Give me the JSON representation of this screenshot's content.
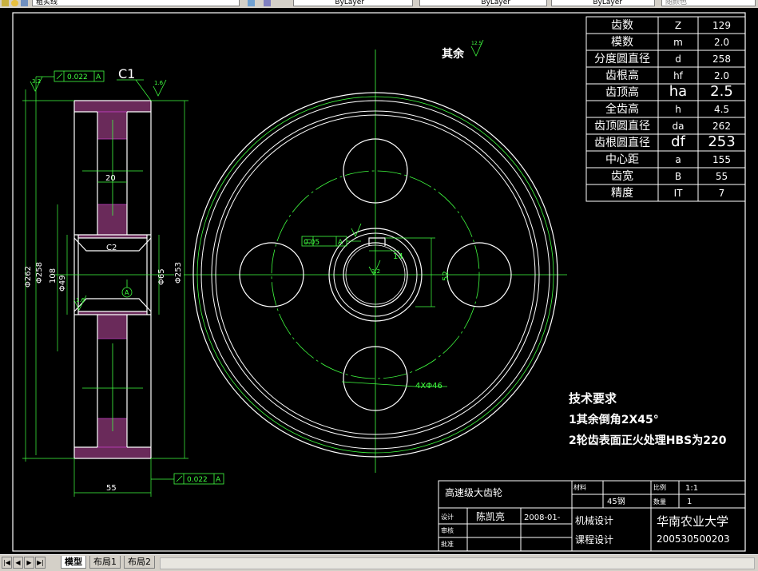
{
  "toolbar": {
    "linetype_value": "粗实线",
    "color_value": "ByLayer",
    "layer_value": "ByLayer",
    "lineweight_value": "ByLayer",
    "plotstyle_value": "随颜色"
  },
  "tabs": {
    "nav": [
      "|◀",
      "◀",
      "▶",
      "▶|"
    ],
    "items": [
      {
        "label": "模型",
        "active": true
      },
      {
        "label": "布局1",
        "active": false
      },
      {
        "label": "布局2",
        "active": false
      }
    ]
  },
  "params_table": [
    {
      "name": "齿数",
      "symbol": "Z",
      "value": "129"
    },
    {
      "name": "模数",
      "symbol": "m",
      "value": "2.0"
    },
    {
      "name": "分度圆直径",
      "symbol": "d",
      "value": "258"
    },
    {
      "name": "齿根高",
      "symbol": "hf",
      "value": "2.0"
    },
    {
      "name": "齿顶高",
      "symbol": "ha",
      "value": "2.5"
    },
    {
      "name": "全齿高",
      "symbol": "h",
      "value": "4.5"
    },
    {
      "name": "齿顶圆直径",
      "symbol": "da",
      "value": "262"
    },
    {
      "name": "齿根圆直径",
      "symbol": "df",
      "value": "253"
    },
    {
      "name": "中心距",
      "symbol": "a",
      "value": "155"
    },
    {
      "name": "齿宽",
      "symbol": "B",
      "value": "55"
    },
    {
      "name": "精度",
      "symbol": "IT",
      "value": "7"
    }
  ],
  "rest_roughness": {
    "label": "其余",
    "value": "12.5"
  },
  "tech": {
    "title": "技术要求",
    "line1": "1其余倒角2X45°",
    "line2": "2轮齿表面正火处理HBS为220"
  },
  "title_block": {
    "part_name": "高速级大齿轮",
    "scale_label": "比例",
    "scale_value": "1:1",
    "material_label": "材料",
    "material_value": "45钢",
    "qty_label": "数量",
    "qty_value": "1",
    "design_label": "设计",
    "designer": "陈凯亮",
    "date": "2008-01-",
    "review_label": "审核",
    "approve_label": "批准",
    "course1": "机械设计",
    "course2": "课程设计",
    "school": "华南农业大学",
    "student_id": "200530500203"
  },
  "section_view": {
    "chamfer_label": "C1",
    "chamfer2_label": "C2",
    "tolerance_top": "0.022",
    "tolerance_bottom": "0.022",
    "datum": "A",
    "roughness_left": "3.2",
    "roughness_right": "1.6",
    "roughness_mid": "1.6",
    "dims": {
      "hub_width": "20",
      "face_width": "55",
      "d262": "Φ262",
      "d258": "Φ258",
      "d253": "Φ253",
      "d108": "108",
      "d49": "Φ49",
      "d65": "Φ65"
    }
  },
  "front_view": {
    "hole_label": "4XΦ46",
    "flatness": "0.05",
    "datum": "A",
    "keyway_width": "14",
    "keyway_depth": "52",
    "roughness": "3.2"
  }
}
